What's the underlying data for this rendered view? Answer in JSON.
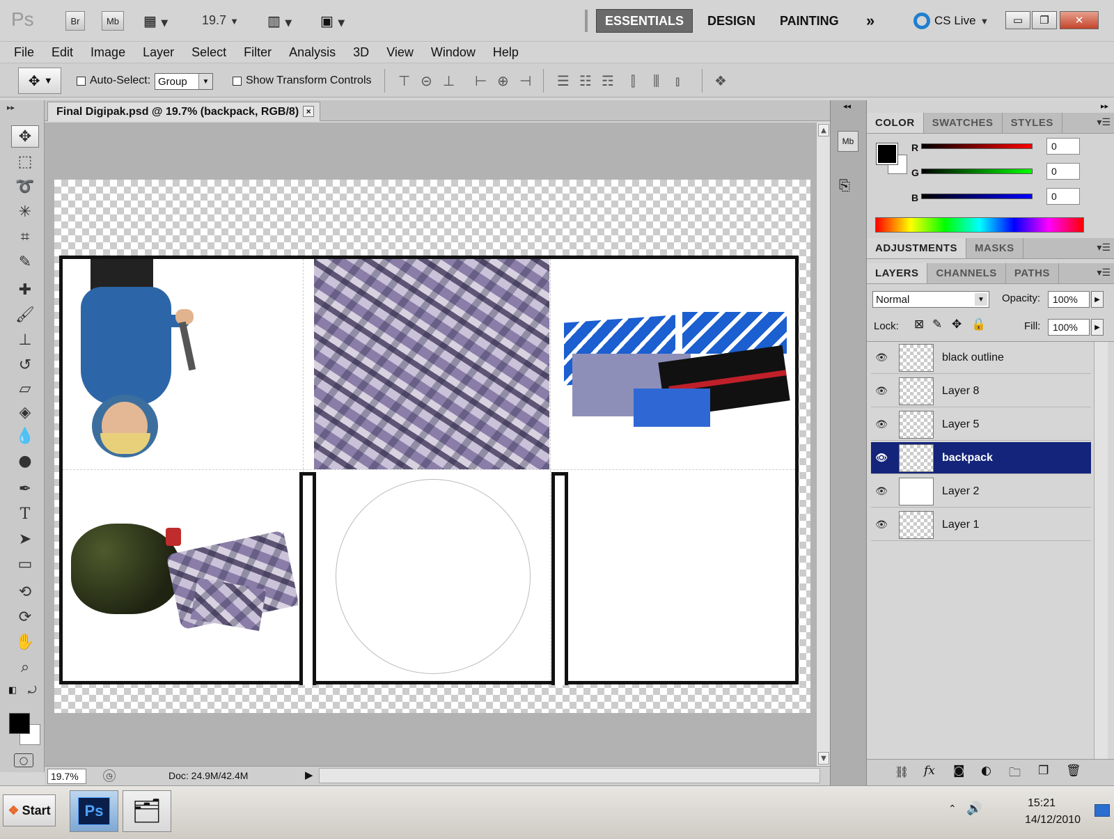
{
  "app": {
    "logo": "Ps",
    "bridge_label": "Br",
    "minibridge_label": "Mb",
    "zoom_select": "19.7",
    "workspaces": [
      "ESSENTIALS",
      "DESIGN",
      "PAINTING"
    ],
    "more_workspaces": "»",
    "cs_live": "CS Live"
  },
  "menubar": [
    "File",
    "Edit",
    "Image",
    "Layer",
    "Select",
    "Filter",
    "Analysis",
    "3D",
    "View",
    "Window",
    "Help"
  ],
  "options_bar": {
    "auto_select_label": "Auto-Select:",
    "auto_select_value": "Group",
    "show_transform_label": "Show Transform Controls"
  },
  "document": {
    "tab_title": "Final Digipak.psd @ 19.7% (backpack, RGB/8)",
    "close_glyph": "×",
    "zoom": "19.7%",
    "doc_size": "Doc: 24.9M/42.4M"
  },
  "color_panel": {
    "tabs": [
      "COLOR",
      "SWATCHES",
      "STYLES"
    ],
    "r_label": "R",
    "g_label": "G",
    "b_label": "B",
    "r": "0",
    "g": "0",
    "b": "0",
    "foreground": "#000000",
    "background": "#ffffff"
  },
  "adjust_panel": {
    "tabs": [
      "ADJUSTMENTS",
      "MASKS"
    ]
  },
  "layers_panel": {
    "tabs": [
      "LAYERS",
      "CHANNELS",
      "PATHS"
    ],
    "blend_mode": "Normal",
    "opacity_label": "Opacity:",
    "opacity": "100%",
    "lock_label": "Lock:",
    "fill_label": "Fill:",
    "fill": "100%",
    "layers": [
      {
        "name": "black outline",
        "selected": false
      },
      {
        "name": "Layer 8",
        "selected": false
      },
      {
        "name": "Layer 5",
        "selected": false
      },
      {
        "name": "backpack",
        "selected": true
      },
      {
        "name": "Layer 2",
        "selected": false
      },
      {
        "name": "Layer 1",
        "selected": false
      }
    ]
  },
  "taskbar": {
    "start_label": "Start",
    "ps_label": "Ps",
    "time": "15:21",
    "date": "14/12/2010"
  }
}
